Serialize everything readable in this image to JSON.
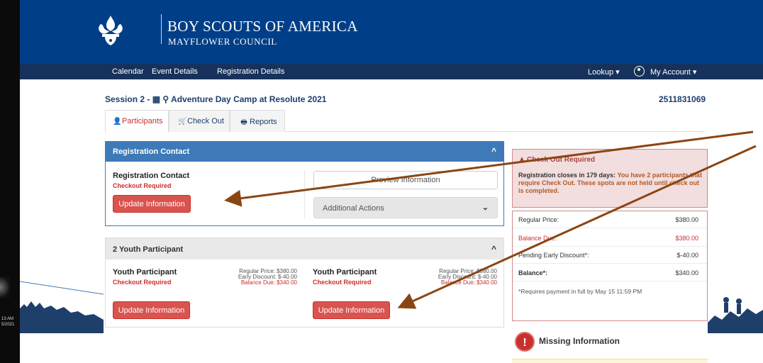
{
  "left_strip": {
    "time": "13 AM",
    "date": "5/2021"
  },
  "brand": {
    "title": "BOY SCOUTS OF AMERICA",
    "subtitle": "MAYFLOWER COUNCIL",
    "emblem_icon": "bsa-fleur-de-lis-icon"
  },
  "nav": {
    "items": [
      "Calendar",
      "Event Details",
      "Registration Details"
    ],
    "lookup": "Lookup ▾",
    "account": "My Account ▾"
  },
  "session": {
    "title": "Session 2 - ▦ ⚲ Adventure Day Camp at Resolute 2021",
    "id": "2511831069"
  },
  "tabs": [
    {
      "label": "Participants",
      "icon": "user-icon"
    },
    {
      "label": "Check Out",
      "icon": "cart-icon"
    },
    {
      "label": "Reports",
      "icon": "print-icon"
    }
  ],
  "registration_contact": {
    "header": "Registration Contact",
    "name": "Registration Contact",
    "status": "Checkout Required",
    "update_button": "Update Information",
    "preview_button": "Preview Information",
    "actions_label": "Additional Actions"
  },
  "youth": {
    "header": "2 Youth Participant",
    "participants": [
      {
        "name": "Youth Participant",
        "status": "Checkout Required",
        "regular": "Regular Price:  $380.00",
        "discount": "Early Discount:  $-40.00",
        "due": "Balance Due:  $340.00",
        "button": "Update Information"
      },
      {
        "name": "Youth Participant",
        "status": "Checkout Required",
        "regular": "Regular Price:  $380.00",
        "discount": "Early Discount:  $-40.00",
        "due": "Balance Due:  $340.00",
        "button": "Update Information"
      }
    ]
  },
  "alert": {
    "title": "Check Out Required",
    "closes": "Registration closes in 179 days:",
    "message": "You have 2 participants that require Check Out. These spots are not held until check out is completed."
  },
  "pricing": {
    "rows": [
      {
        "label": "Regular Price:",
        "value": "$380.00"
      },
      {
        "label": "Balance Due:",
        "value": "$380.00"
      },
      {
        "label": "Pending Early Discount*:",
        "value": "$-40.00"
      },
      {
        "label": "Balance*:",
        "value": "$340.00"
      }
    ],
    "note": "*Requires payment in full by May 15 11:59 PM"
  },
  "missing": {
    "label": "Missing Information",
    "icon": "exclamation-icon"
  },
  "colors": {
    "header_blue": "#003f87",
    "nav_blue": "#16325c",
    "panel_blue": "#3e7ab8",
    "danger": "#d9534f",
    "arrow": "#8b4513"
  }
}
